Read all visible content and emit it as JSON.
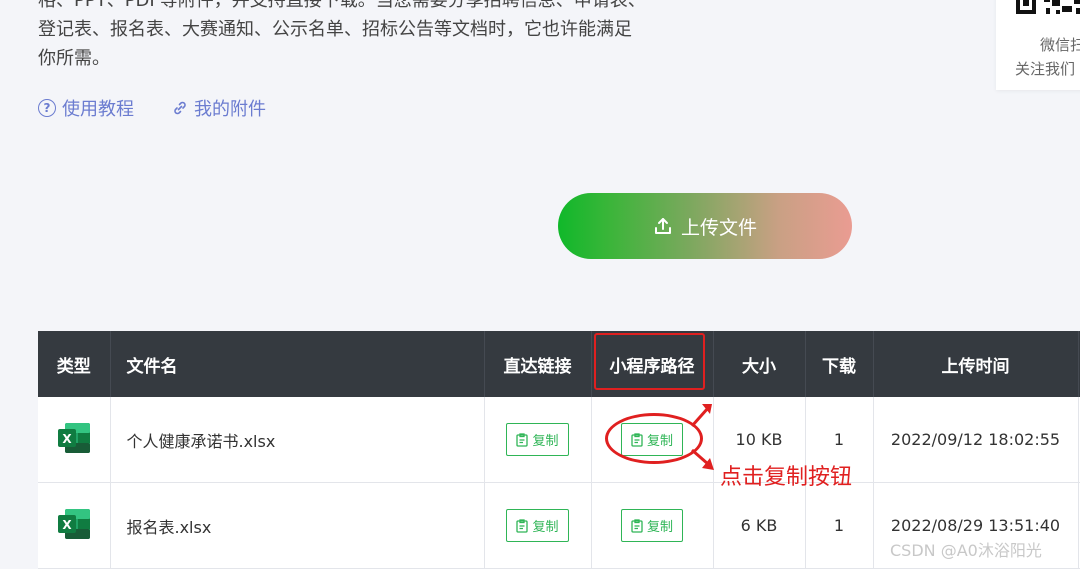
{
  "intro": {
    "line1": "格、PPT、PDF等附件，并支持直接下载。当您需要分享招聘信息、申请表、",
    "line2": "登记表、报名表、大赛通知、公示名单、招标公告等文档时，它也许能满足",
    "line3": "你所需。"
  },
  "links": {
    "tutorial": "使用教程",
    "attachments": "我的附件"
  },
  "side_card": {
    "line1": "微信扫",
    "line2": "关注我们"
  },
  "upload": {
    "label": "上传文件"
  },
  "table": {
    "headers": {
      "type": "类型",
      "name": "文件名",
      "direct_link": "直达链接",
      "mini_path": "小程序路径",
      "size": "大小",
      "downloads": "下载",
      "upload_time": "上传时间"
    },
    "rows": [
      {
        "name": "个人健康承诺书.xlsx",
        "direct": "复制",
        "mini": "复制",
        "size": "10 KB",
        "downloads": "1",
        "time": "2022/09/12 18:02:55"
      },
      {
        "name": "报名表.xlsx",
        "direct": "复制",
        "mini": "复制",
        "size": "6 KB",
        "downloads": "1",
        "time": "2022/08/29 13:51:40"
      }
    ]
  },
  "annotation": {
    "text": "点击复制按钮"
  },
  "watermark": "CSDN @A0沐浴阳光",
  "colors": {
    "accent_green": "#2fb556",
    "annot_red": "#e02020",
    "header_bg": "#353a40",
    "link_blue": "#6b7cd0"
  },
  "icons": [
    "help-circle-icon",
    "link-icon",
    "upload-icon",
    "excel-file-icon",
    "clipboard-icon",
    "qr-code-icon"
  ]
}
